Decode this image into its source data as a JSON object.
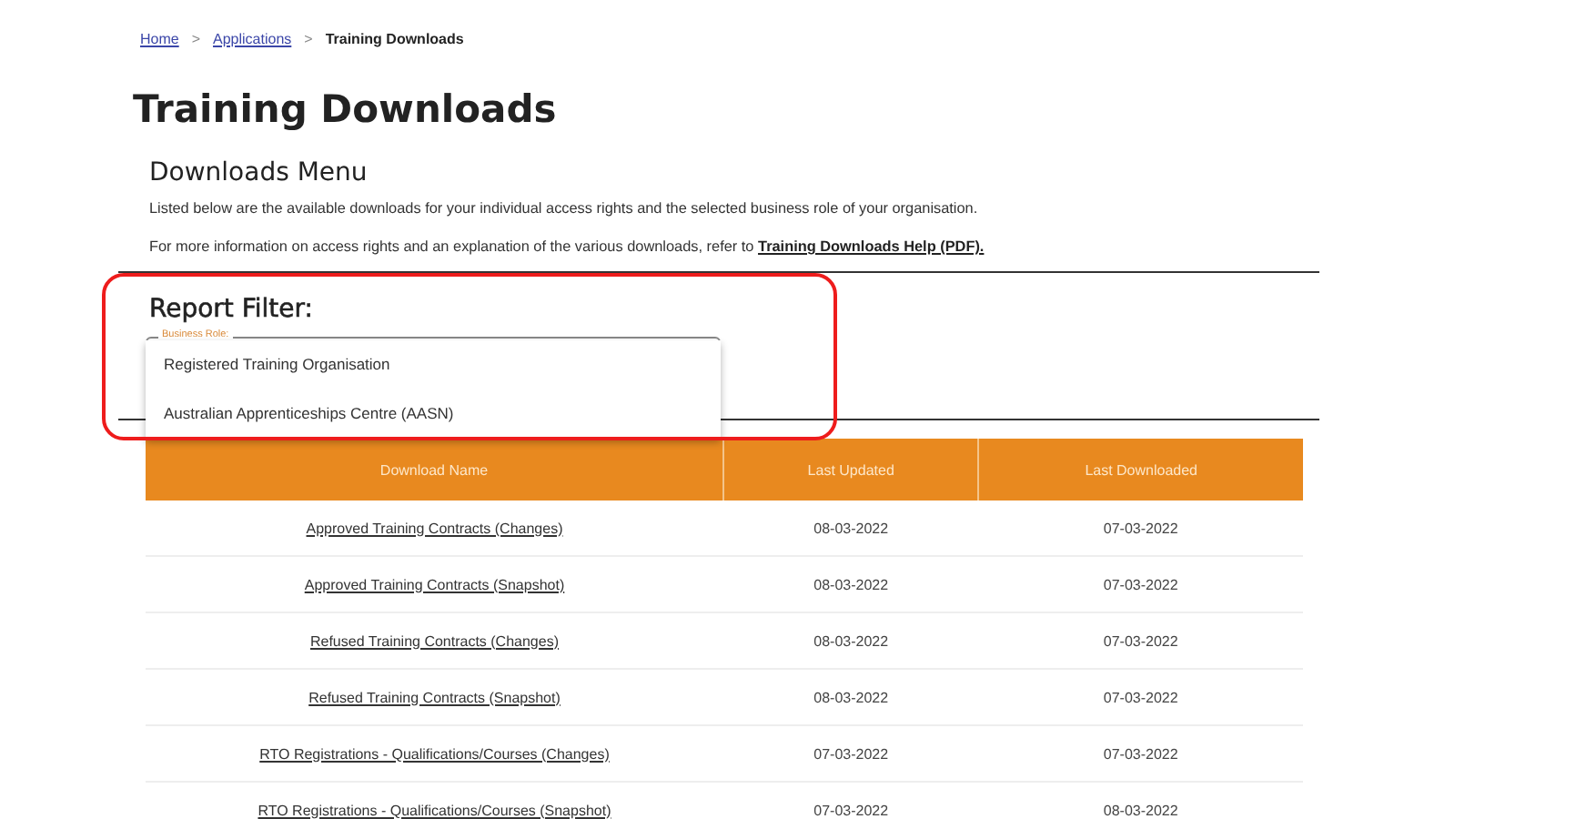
{
  "breadcrumb": [
    {
      "label": "Home",
      "kind": "link"
    },
    {
      "label": "Applications",
      "kind": "link"
    },
    {
      "label": "Training Downloads",
      "kind": "current"
    }
  ],
  "separator": ">",
  "title": "Training Downloads",
  "section": {
    "title": "Downloads Menu",
    "intro": "Listed below are the available downloads for your individual access rights and the selected business role of your organisation.",
    "help_text": "For more information on access rights and an explanation of the various downloads, refer to ",
    "help_link": "Training Downloads Help (PDF)."
  },
  "filter": {
    "title": "Report Filter:",
    "field_label": "Business Role:",
    "options": [
      "Registered Training Organisation",
      "Australian Apprenticeships Centre (AASN)"
    ]
  },
  "table": {
    "columns": [
      "Download Name",
      "Last Updated",
      "Last Downloaded"
    ],
    "rows": [
      [
        "Approved Training Contracts (Changes)",
        "08-03-2022",
        "07-03-2022"
      ],
      [
        "Approved Training Contracts (Snapshot)",
        "08-03-2022",
        "07-03-2022"
      ],
      [
        "Refused Training Contracts (Changes)",
        "08-03-2022",
        "07-03-2022"
      ],
      [
        "Refused Training Contracts (Snapshot)",
        "08-03-2022",
        "07-03-2022"
      ],
      [
        "RTO Registrations - Qualifications/Courses (Changes)",
        "07-03-2022",
        "07-03-2022"
      ],
      [
        "RTO Registrations - Qualifications/Courses (Snapshot)",
        "07-03-2022",
        "08-03-2022"
      ]
    ]
  }
}
